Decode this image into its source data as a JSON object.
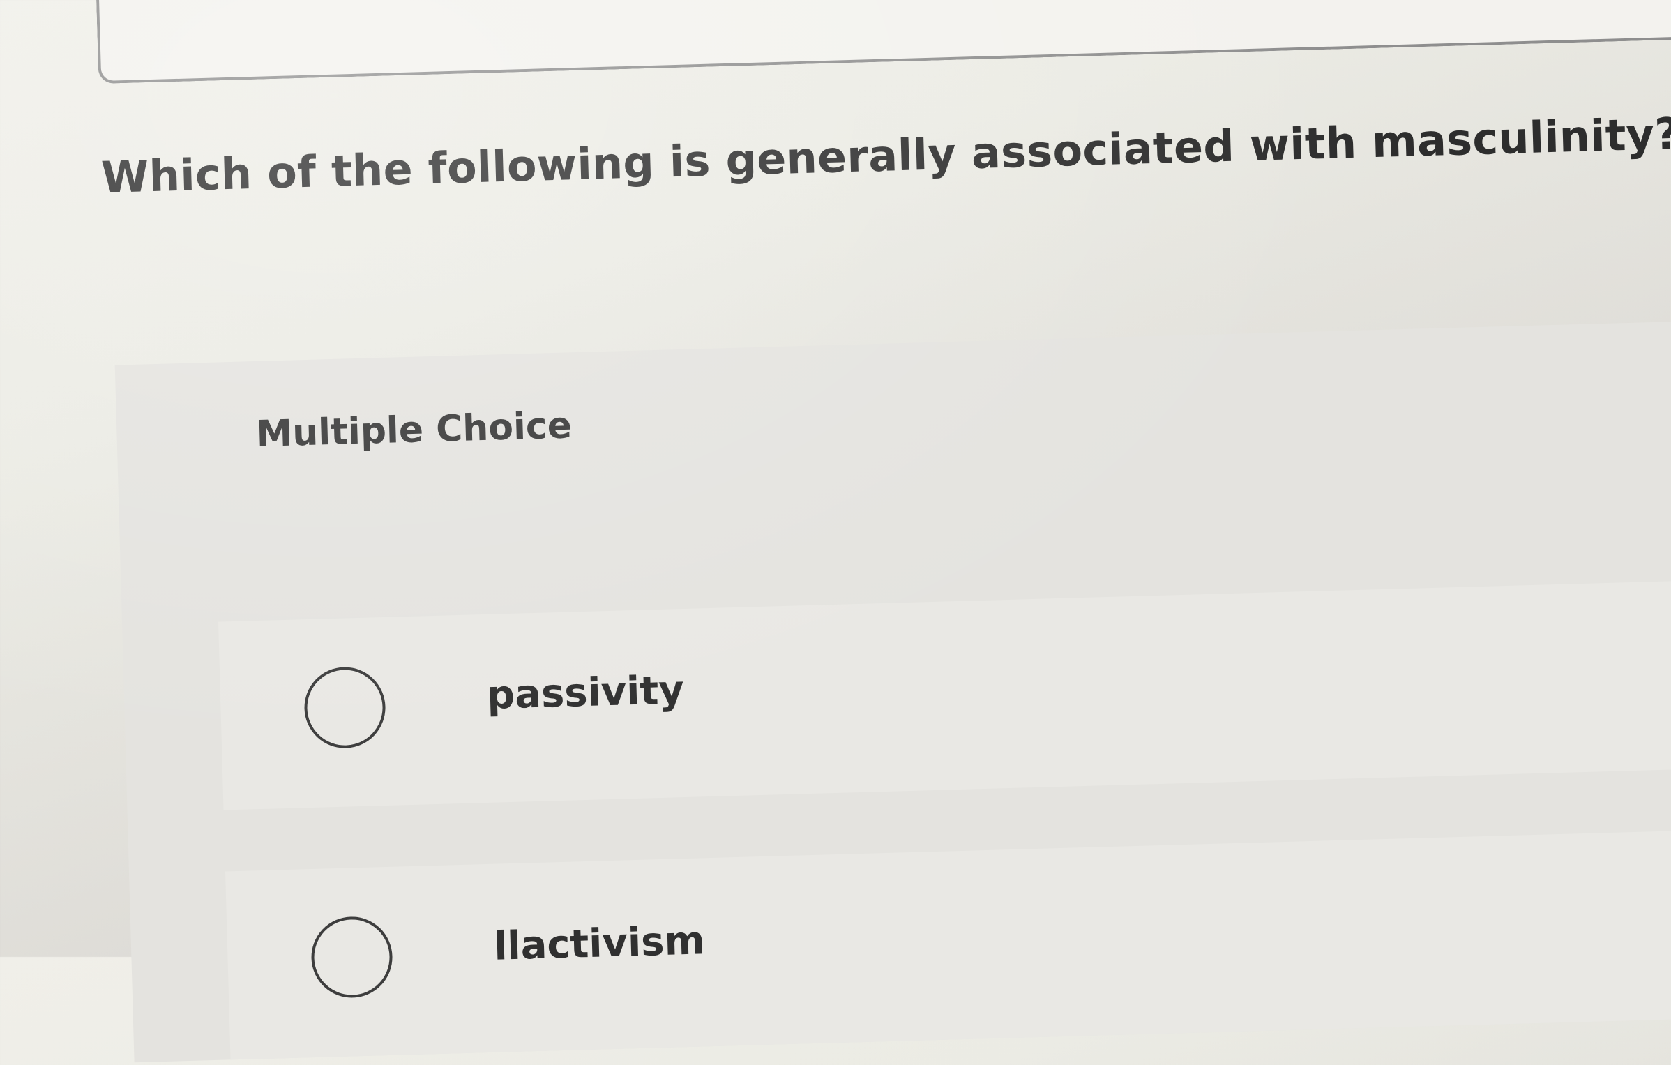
{
  "question": {
    "text": "Which of the following is generally associated with masculinity?"
  },
  "choice_section": {
    "type_label": "Multiple Choice",
    "options": [
      {
        "label": "passivity",
        "selected": false
      },
      {
        "label": "llactivism",
        "selected": false
      }
    ]
  },
  "colors": {
    "text": "#2d2d2d",
    "radio_border": "#3d3d3d",
    "panel_bg": "#e4e3df"
  }
}
